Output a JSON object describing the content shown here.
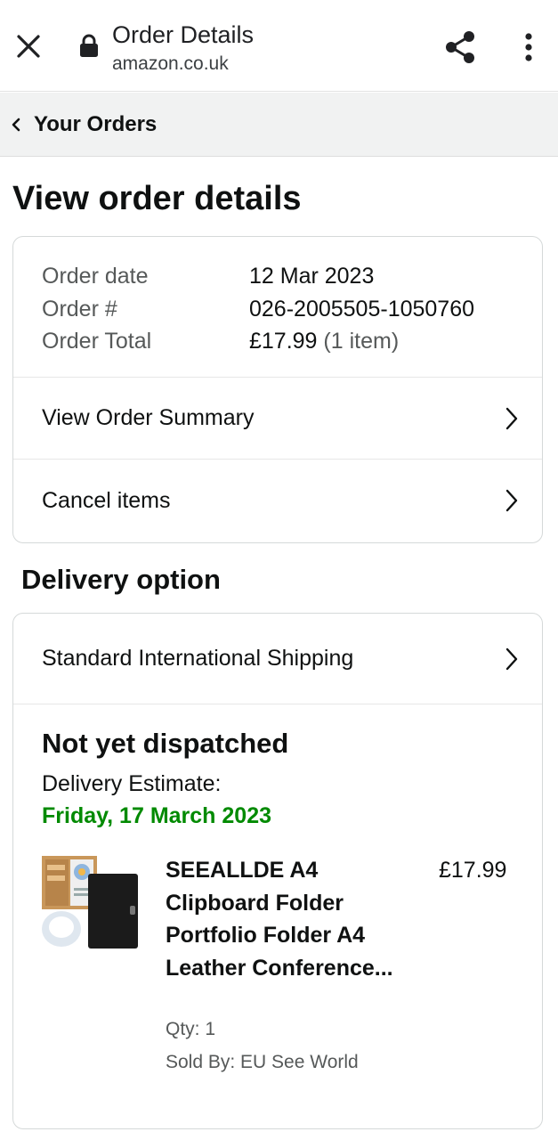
{
  "browser": {
    "title": "Order Details",
    "url": "amazon.co.uk",
    "icons": {
      "close": "close-icon",
      "lock": "lock-icon",
      "share": "share-icon",
      "menu": "more-vert-icon"
    }
  },
  "breadcrumb": {
    "label": "Your Orders"
  },
  "page": {
    "heading": "View order details"
  },
  "order": {
    "rows": [
      {
        "label": "Order date",
        "value": "12 Mar 2023"
      },
      {
        "label": "Order #",
        "value": "026-2005505-1050760"
      },
      {
        "label": "Order Total",
        "value": "£17.99",
        "extra": "(1 item)"
      }
    ],
    "links": [
      "View Order Summary",
      "Cancel items"
    ]
  },
  "delivery": {
    "heading": "Delivery option",
    "option": "Standard International Shipping",
    "status": "Not yet dispatched",
    "estimate_label": "Delivery Estimate:",
    "estimate_date": "Friday, 17 March 2023",
    "estimate_color": "#008a00"
  },
  "product": {
    "name": "SEEALLDE A4 Clipboard Folder Portfolio Folder A4 Leather Conference...",
    "price": "£17.99",
    "qty": "Qty: 1",
    "seller": "Sold By: EU See World"
  }
}
